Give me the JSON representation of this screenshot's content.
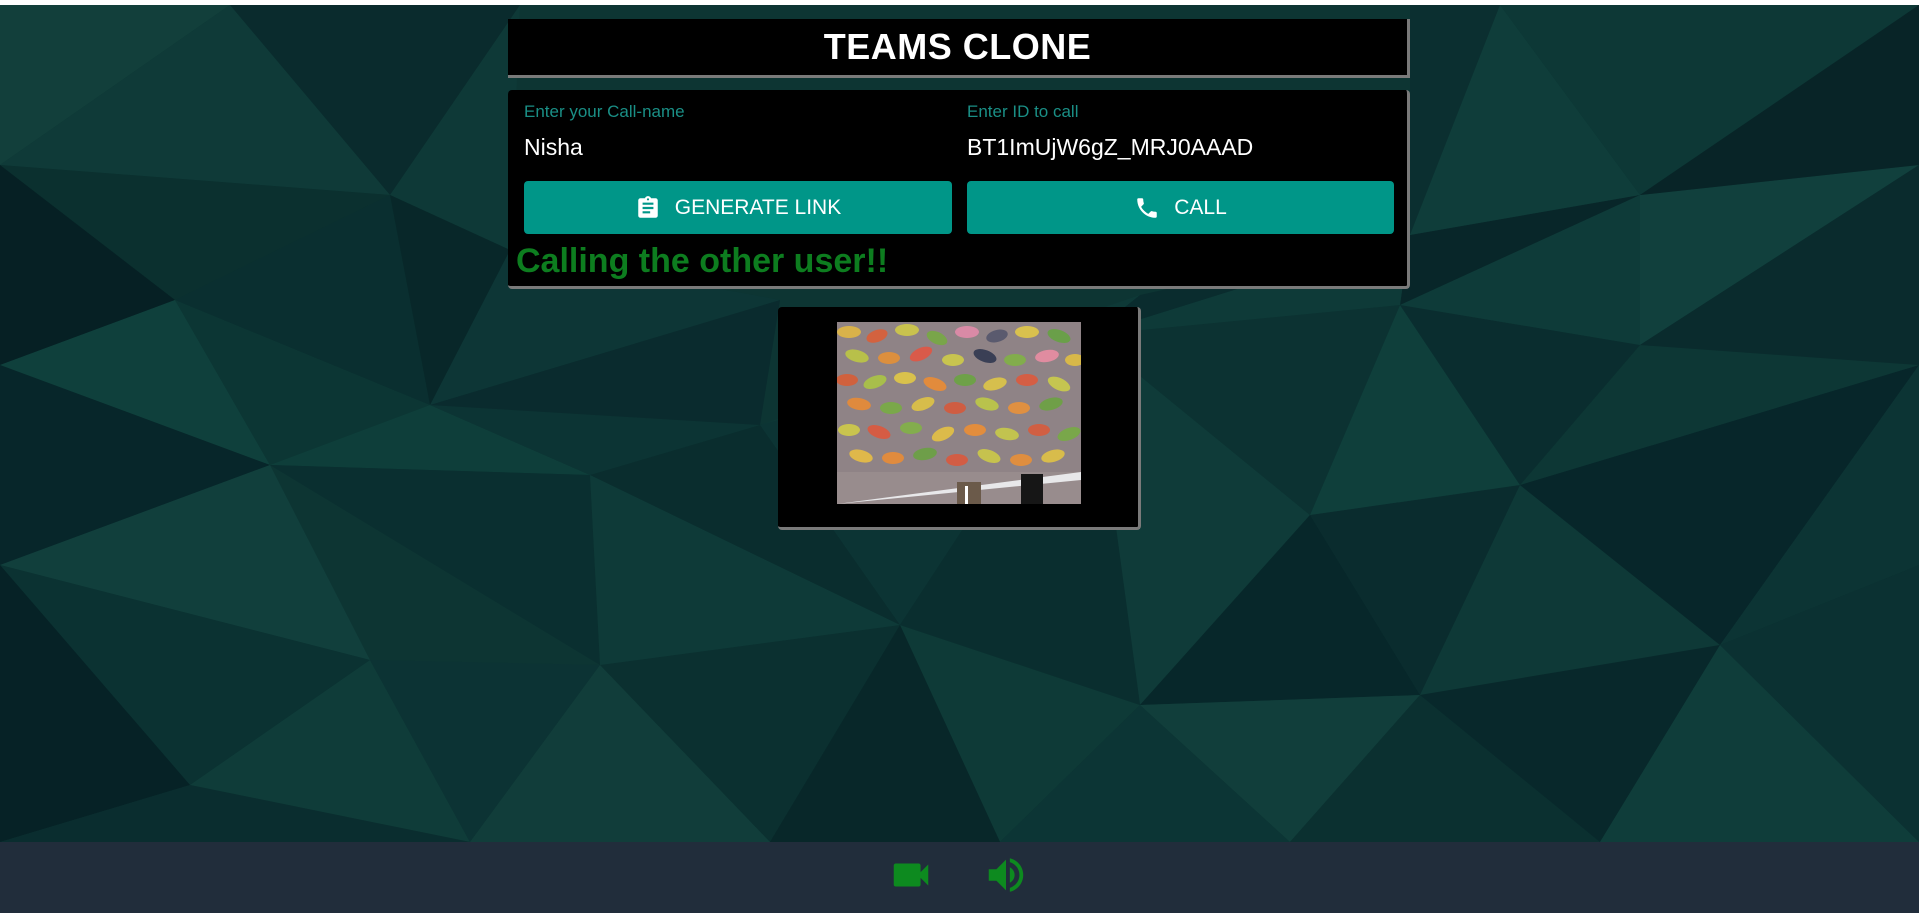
{
  "app": {
    "title": "TEAMS CLONE"
  },
  "form": {
    "callname_label": "Enter your Call-name",
    "callname_value": "Nisha",
    "id_label": "Enter ID to call",
    "id_value": "BT1ImUjW6gZ_MRJ0AAAD",
    "generate_label": "GENERATE LINK",
    "call_label": "CALL"
  },
  "status": {
    "text": "Calling the other user!!"
  },
  "icons": {
    "generate": "clipboard-icon",
    "call": "phone-icon",
    "video": "video-camera-icon",
    "audio": "speaker-volume-icon"
  },
  "colors": {
    "accent": "#009688",
    "label": "#1a8f86",
    "status": "#0d7d1f",
    "control_icon": "#0d8a1f",
    "control_bar": "#212d3b"
  }
}
